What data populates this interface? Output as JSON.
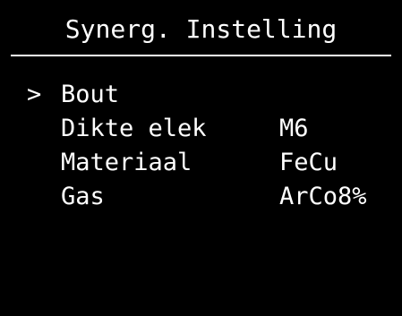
{
  "header": {
    "title": "Synerg. Instelling"
  },
  "menu": {
    "cursor": ">",
    "items": [
      {
        "label": "Bout",
        "value": "",
        "selected": true
      },
      {
        "label": "Dikte elek",
        "value": "M6",
        "selected": false
      },
      {
        "label": "Materiaal",
        "value": "FeCu",
        "selected": false
      },
      {
        "label": "Gas",
        "value": "ArCo8%",
        "selected": false
      }
    ]
  },
  "colors": {
    "background": "#000000",
    "foreground": "#ffffff"
  }
}
